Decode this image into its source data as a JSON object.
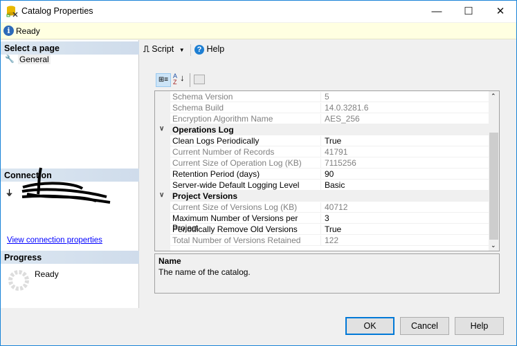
{
  "window": {
    "title": "Catalog Properties",
    "minimize": "—",
    "maximize": "☐",
    "close": "✕"
  },
  "infobar": {
    "status": "Ready"
  },
  "left": {
    "select_page_header": "Select a page",
    "pages": [
      {
        "label": "General",
        "icon": "wrench-icon"
      }
    ],
    "connection_header": "Connection",
    "view_connection_link": "View connection properties",
    "progress_header": "Progress",
    "progress_status": "Ready"
  },
  "toolbar": {
    "script_label": "Script",
    "help_label": "Help"
  },
  "grid": {
    "rows": [
      {
        "type": "prop",
        "name": "Schema Version",
        "value": "5",
        "readonly": true
      },
      {
        "type": "prop",
        "name": "Schema Build",
        "value": "14.0.3281.6",
        "readonly": true
      },
      {
        "type": "prop",
        "name": "Encryption Algorithm Name",
        "value": "AES_256",
        "readonly": true
      },
      {
        "type": "cat",
        "name": "Operations Log"
      },
      {
        "type": "prop",
        "name": "Clean Logs Periodically",
        "value": "True",
        "readonly": false
      },
      {
        "type": "prop",
        "name": "Current Number of Records",
        "value": "41791",
        "readonly": true
      },
      {
        "type": "prop",
        "name": "Current Size of Operation Log (KB)",
        "value": "7115256",
        "readonly": true
      },
      {
        "type": "prop",
        "name": "Retention Period (days)",
        "value": "90",
        "readonly": false
      },
      {
        "type": "prop",
        "name": "Server-wide Default Logging Level",
        "value": "Basic",
        "readonly": false
      },
      {
        "type": "cat",
        "name": "Project Versions"
      },
      {
        "type": "prop",
        "name": "Current Size of Versions Log (KB)",
        "value": "40712",
        "readonly": true
      },
      {
        "type": "prop",
        "name": "Maximum Number of Versions per Project",
        "value": "3",
        "readonly": false
      },
      {
        "type": "prop",
        "name": "Periodically Remove Old Versions",
        "value": "True",
        "readonly": false
      },
      {
        "type": "prop",
        "name": "Total Number of Versions Retained",
        "value": "122",
        "readonly": true
      }
    ]
  },
  "description": {
    "title": "Name",
    "text": "The name of the catalog."
  },
  "buttons": {
    "ok": "OK",
    "cancel": "Cancel",
    "help": "Help"
  }
}
